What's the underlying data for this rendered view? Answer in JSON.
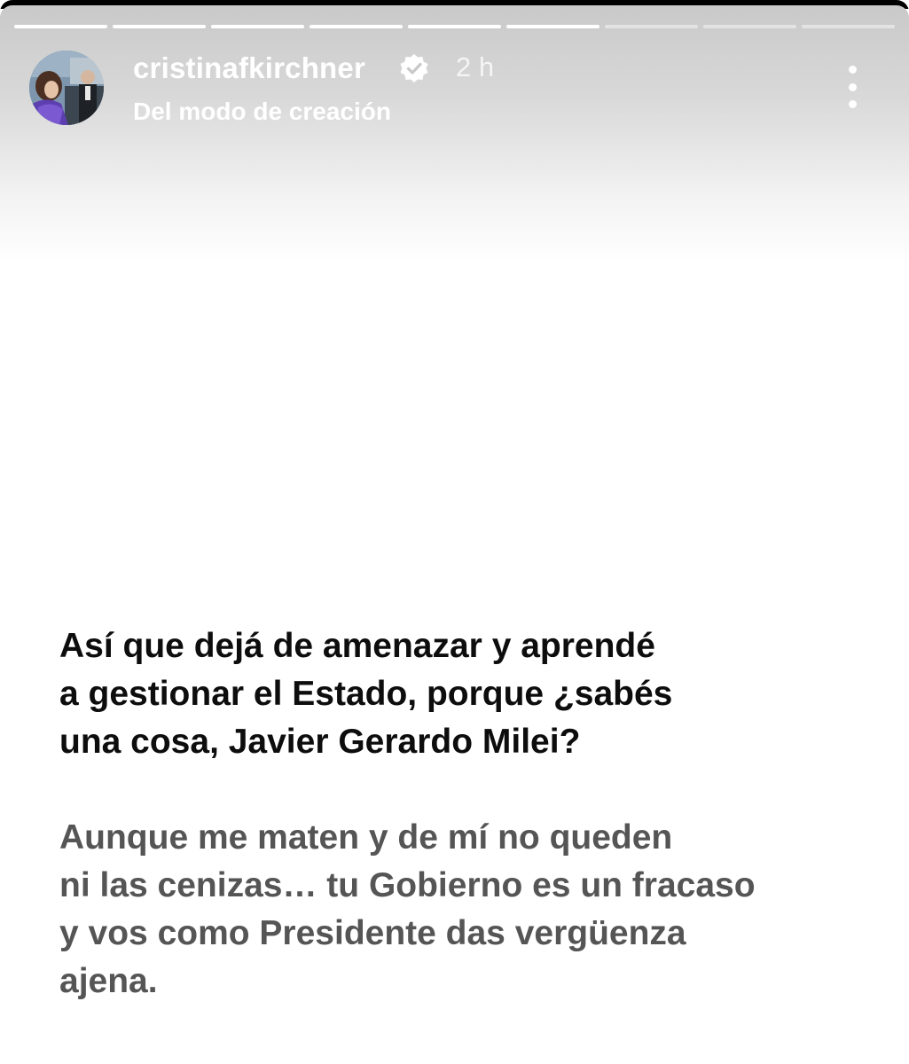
{
  "story": {
    "progress_segments": 9,
    "progress_seen": 6,
    "author": {
      "username": "cristinafkirchner",
      "verified": true,
      "time_ago": "2 h",
      "subtitle": "Del modo de creación",
      "avatar_icon": "profile-photo"
    },
    "more_icon": "vertical-ellipsis-icon",
    "text": {
      "paragraph1": "Así que dejá de amenazar y aprendé\na gestionar el Estado, porque ¿sabés\nuna cosa, Javier Gerardo Milei?",
      "paragraph2": "Aunque me maten y de mí no queden\nni las cenizas… tu Gobierno es un fracaso\ny vos como Presidente das vergüenza\najena."
    },
    "colors": {
      "paragraph1": "#0d0d0d",
      "paragraph2": "#555555",
      "verified_badge": "#ffffff"
    }
  }
}
